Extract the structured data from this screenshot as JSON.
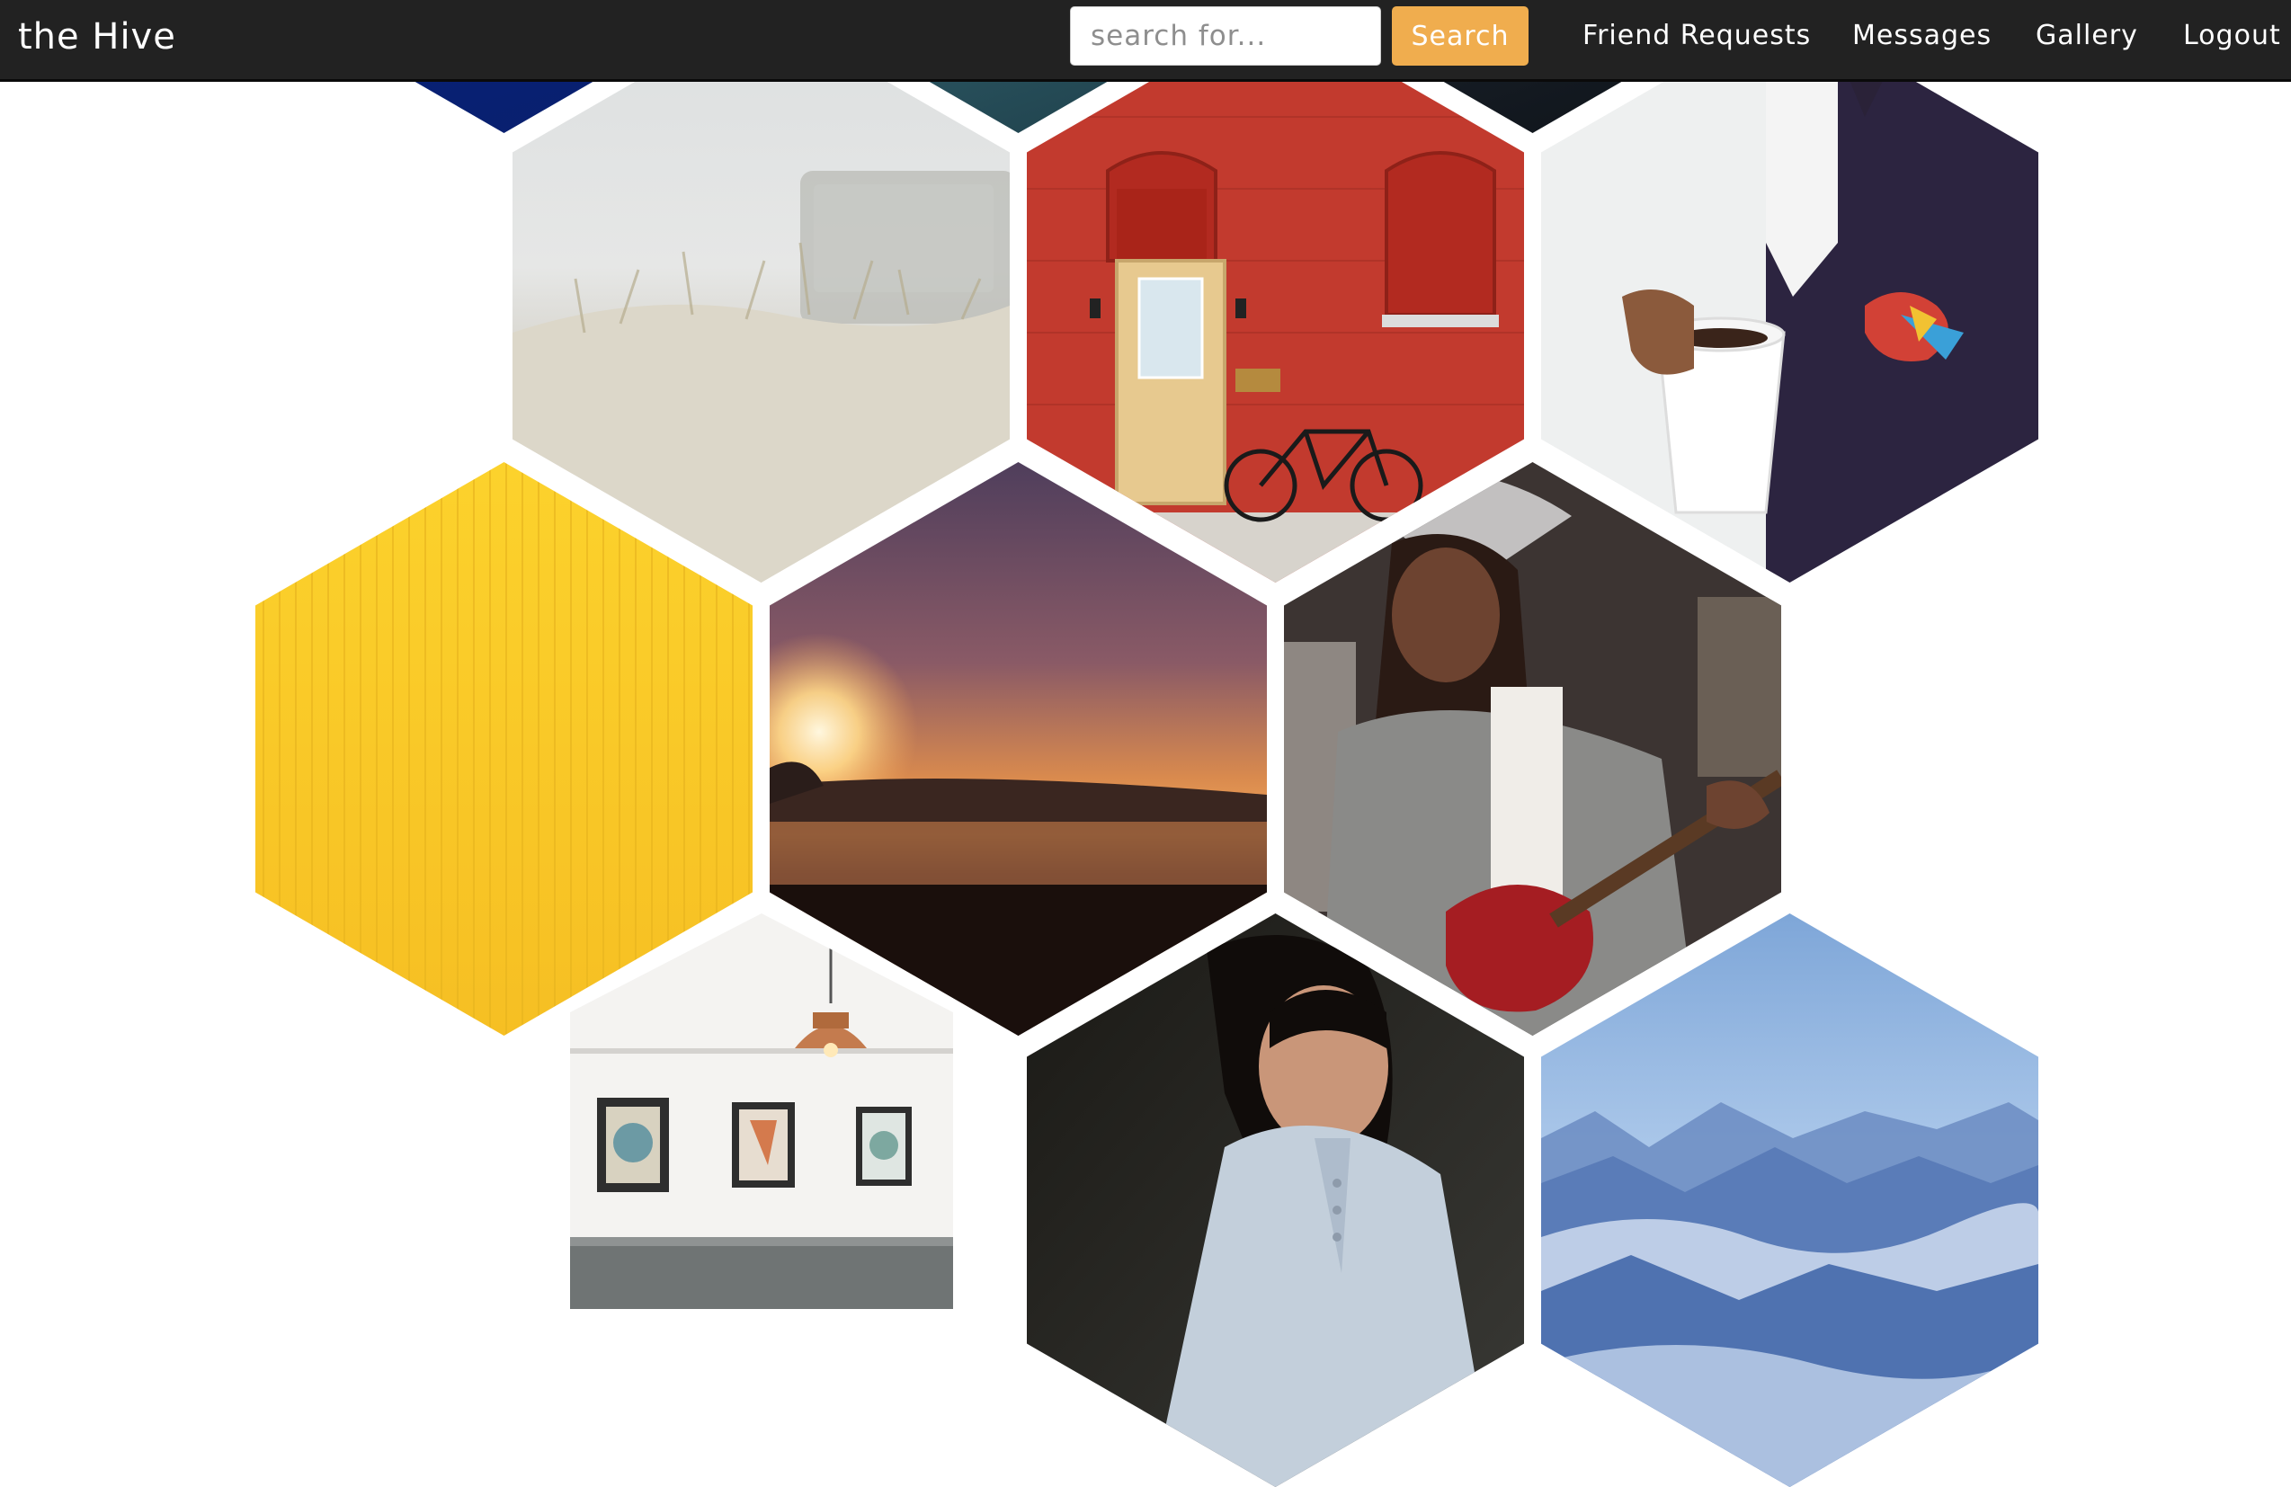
{
  "navbar": {
    "brand": "the Hive",
    "search": {
      "placeholder": "search for...",
      "value": "",
      "button_label": "Search"
    },
    "links": [
      "Friend Requests",
      "Messages",
      "Gallery",
      "Logout"
    ]
  },
  "colors": {
    "navbar_bg": "#222222",
    "search_button": "#f0ad4e",
    "page_bg": "#ffffff"
  },
  "gallery": {
    "layout": "hexagon-honeycomb",
    "tiles": [
      {
        "icon": "blue-abstract-photo"
      },
      {
        "icon": "sea-photo"
      },
      {
        "icon": "dark-photo"
      },
      {
        "icon": "beach-grass-photo"
      },
      {
        "icon": "red-brick-house-photo"
      },
      {
        "icon": "man-coffee-photo"
      },
      {
        "icon": "yellow-wall-photo"
      },
      {
        "icon": "ocean-sunset-photo"
      },
      {
        "icon": "woman-guitar-photo"
      },
      {
        "icon": "room-frames-photo"
      },
      {
        "icon": "woman-portrait-photo"
      },
      {
        "icon": "blue-mountains-photo"
      }
    ]
  }
}
